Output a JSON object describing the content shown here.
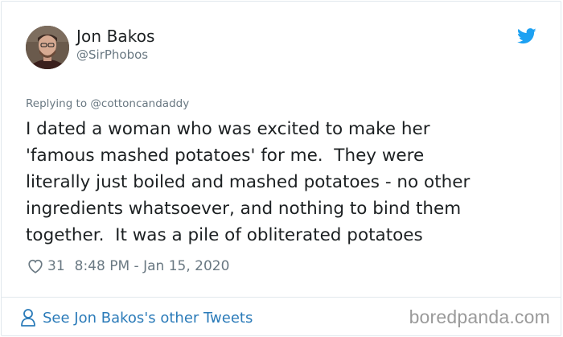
{
  "tweet": {
    "author_name": "Jon Bakos",
    "author_handle": "@SirPhobos",
    "replying_prefix": "Replying to ",
    "replying_user": "@cottoncandaddy",
    "text_lines": [
      "I dated a woman who was excited to make her",
      "'famous mashed potatoes' for me.  They were",
      "literally just boiled and mashed potatoes - no other",
      "ingredients whatsoever, and nothing to bind them",
      "together.  It was a pile of obliterated potatoes"
    ],
    "likes": "31",
    "timestamp": "8:48 PM - Jan 15, 2020"
  },
  "footer": {
    "see_more_label": "See Jon Bakos's other Tweets"
  },
  "watermark": "boredpanda.com",
  "icons": {
    "brand": "twitter-bird-icon",
    "like": "heart-icon",
    "profile": "person-icon"
  },
  "colors": {
    "twitter_blue": "#1da1f2",
    "link_blue": "#2b7bb9",
    "muted_gray": "#697882",
    "text": "#1c2022"
  }
}
